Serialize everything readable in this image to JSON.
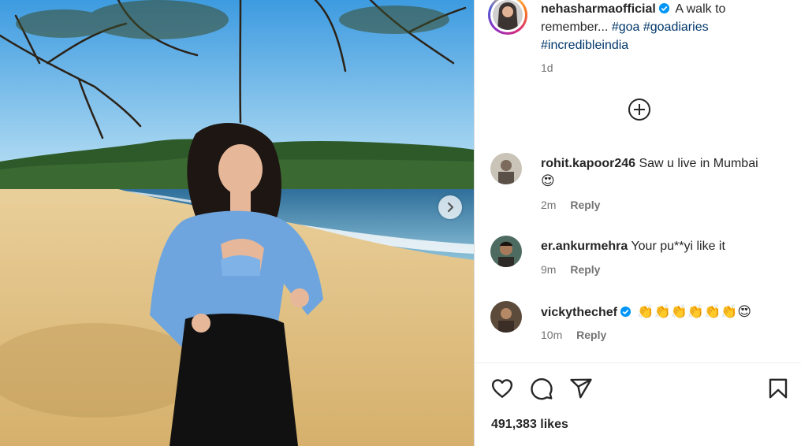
{
  "post": {
    "username": "nehasharmaofficial",
    "caption_lines": [
      "A walk to",
      "remember..."
    ],
    "hashtags": [
      "#goa",
      "#goadiaries",
      "#incredibleindia"
    ],
    "age": "1d",
    "likes": "491,383 likes"
  },
  "comments": [
    {
      "username": "rohit.kapoor246",
      "text": "Saw u live in Mumbai",
      "emoji": "😍",
      "time": "2m",
      "reply": "Reply",
      "verified": false
    },
    {
      "username": "er.ankurmehra",
      "text": "Your pu**yi like it",
      "emoji": "",
      "time": "9m",
      "reply": "Reply",
      "verified": false
    },
    {
      "username": "vickythechef",
      "text": "",
      "emoji": "👏👏👏👏👏👏😍",
      "time": "10m",
      "reply": "Reply",
      "verified": true
    }
  ],
  "colors": {
    "verified_blue": "#0095f6",
    "hashtag": "#00376b",
    "muted": "#737373"
  },
  "icons": [
    "heart-icon",
    "comment-icon",
    "share-icon",
    "bookmark-icon",
    "add-circle-icon",
    "chevron-right-icon",
    "verified-badge-icon"
  ]
}
